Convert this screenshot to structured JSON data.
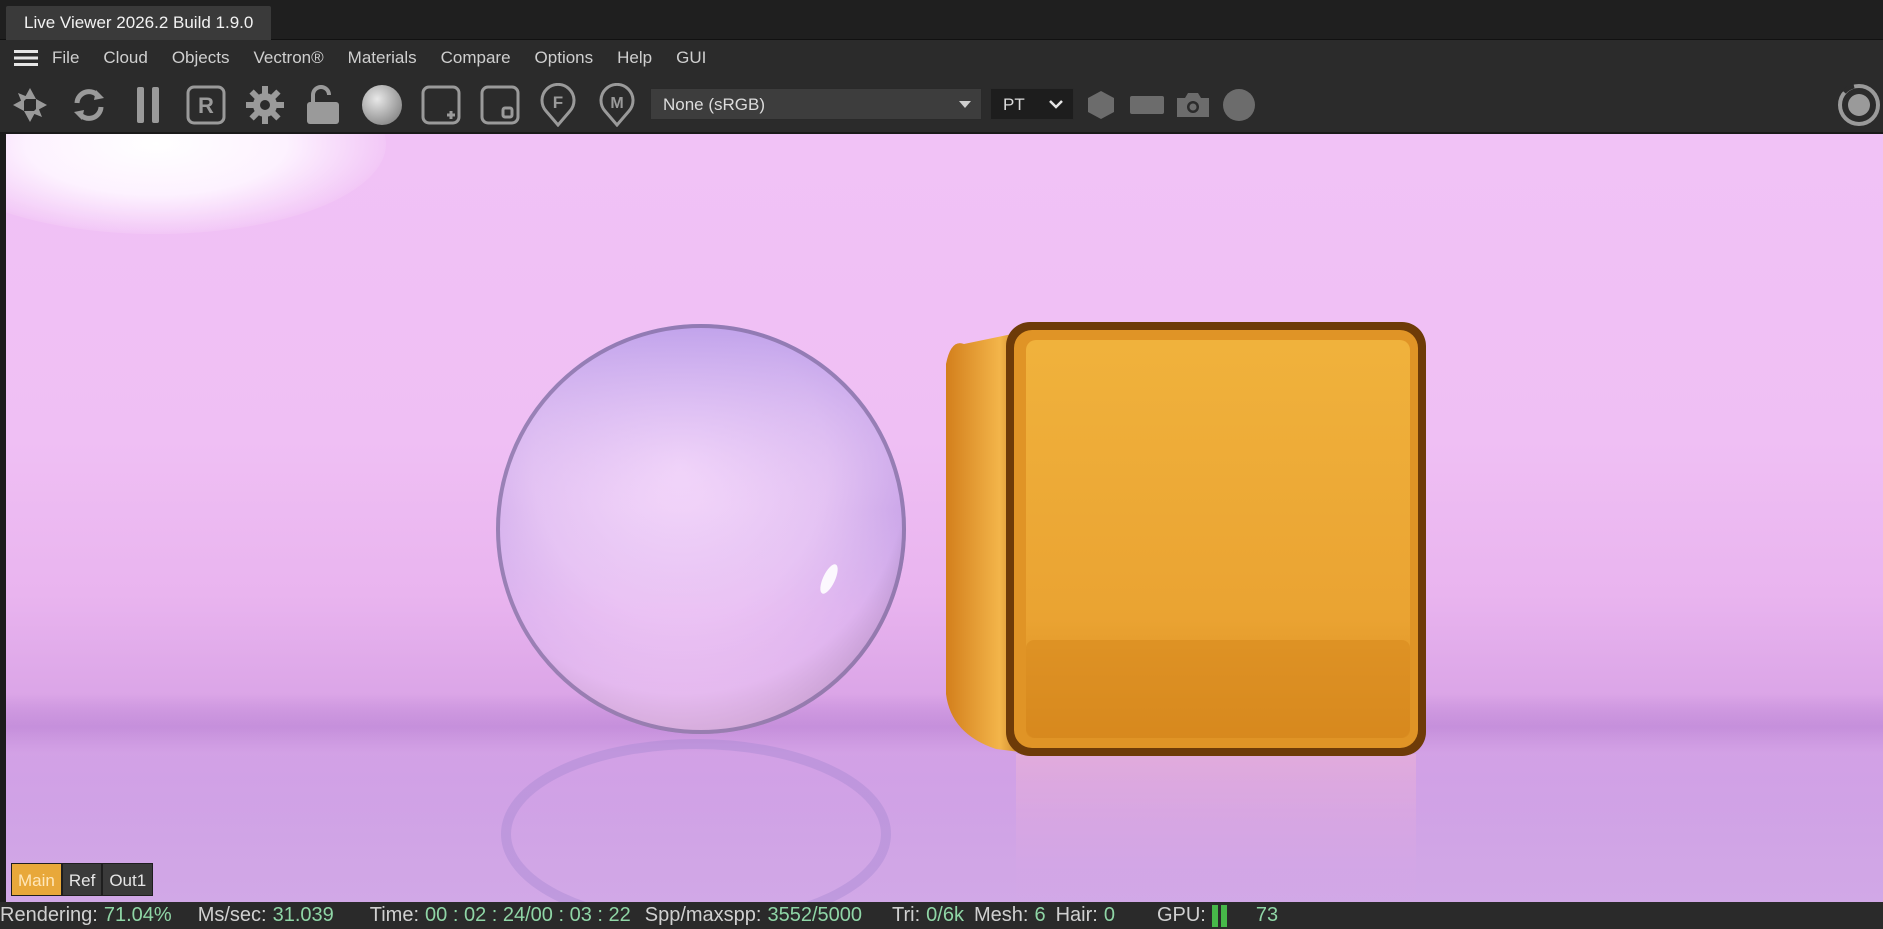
{
  "window": {
    "tab_title": "Live Viewer 2026.2 Build 1.9.0"
  },
  "menu": {
    "items": [
      "File",
      "Cloud",
      "Objects",
      "Vectron®",
      "Materials",
      "Compare",
      "Options",
      "Help",
      "GUI"
    ]
  },
  "toolbar": {
    "icons": [
      "aperture-icon",
      "refresh-icon",
      "pause-icon",
      "region-r-icon",
      "settings-gear-icon",
      "unlock-icon",
      "sphere-icon",
      "add-square-icon",
      "square-small-icon",
      "focus-f-icon",
      "material-m-icon"
    ],
    "color_space": {
      "selected": "None (sRGB)"
    },
    "kernel": {
      "selected": "PT"
    },
    "right_icons": [
      "hexagon-icon",
      "rectangle-icon",
      "camera-icon",
      "circle-icon"
    ],
    "far_right_icon": "target-ring-icon"
  },
  "buffers": [
    {
      "label": "Main",
      "active": true
    },
    {
      "label": "Ref",
      "active": false
    },
    {
      "label": "Out1",
      "active": false
    }
  ],
  "status": {
    "rendering_label": "Rendering:",
    "rendering_value": "71.04%",
    "mssec_label": "Ms/sec:",
    "mssec_value": "31.039",
    "time_label": "Time:",
    "time_value": "00 : 02 : 24/00 : 03 : 22",
    "spp_label": "Spp/maxspp:",
    "spp_value": "3552/5000",
    "tri_label": "Tri:",
    "tri_value": "0/6k",
    "mesh_label": "Mesh:",
    "mesh_value": "6",
    "hair_label": "Hair:",
    "hair_value": "0",
    "gpu_label": "GPU:",
    "gpu_value": "73"
  },
  "colors": {
    "accent_active": "#e8a83a",
    "status_value": "#8fd6a6",
    "gpu_bar": "#47b849",
    "viewport_bg": "#f1c2f6",
    "cube_gold": "#eeae3a"
  }
}
